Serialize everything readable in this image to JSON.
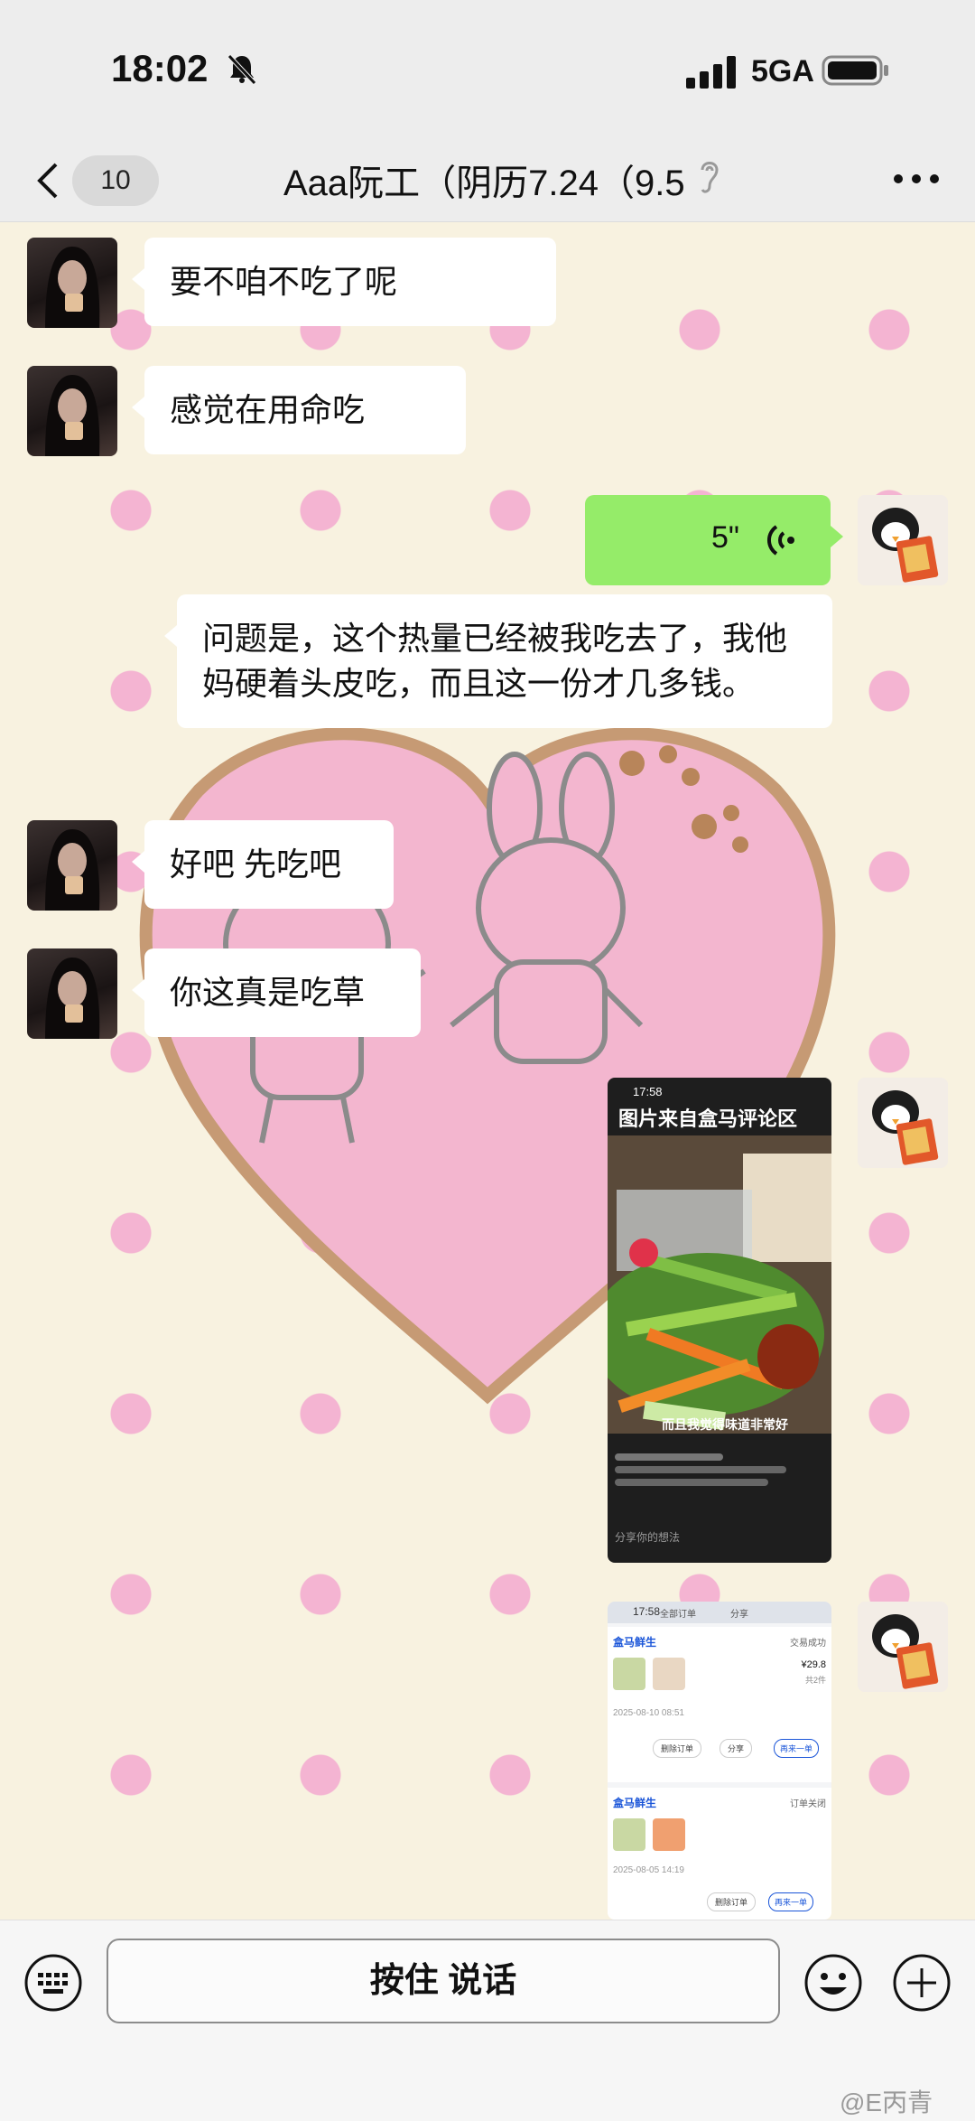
{
  "status_bar": {
    "time": "18:02",
    "network": "5GA"
  },
  "nav": {
    "back_count": "10",
    "title": "Aaa阮工（阴历7.24（9.5"
  },
  "messages": [
    {
      "from": "other",
      "text": "要不咱不吃了呢"
    },
    {
      "from": "other",
      "text": "感觉在用命吃"
    },
    {
      "from": "self",
      "type": "voice",
      "duration": "5\""
    },
    {
      "from": "other",
      "text": "问题是，这个热量已经被我吃去了，我他妈硬着头皮吃，而且这一份才几多钱。"
    },
    {
      "from": "other",
      "text": "好吧 先吃吧"
    },
    {
      "from": "other",
      "text": "你这真是吃草"
    },
    {
      "from": "self",
      "type": "image",
      "screenshot": {
        "time": "17:58",
        "title": "图片来自盒马评论区",
        "caption": "而且我觉得味道非常好",
        "comment_placeholder": "分享你的想法"
      }
    },
    {
      "from": "self",
      "type": "image",
      "screenshot": {
        "time": "17:58",
        "tab_orders": "全部订单",
        "tab_share": "分享",
        "store1": "盒马鲜生",
        "status1": "交易成功",
        "price1": "¥29.8",
        "count1": "共2件",
        "date1": "2025-08-10 08:51",
        "btn_delete": "删除订单",
        "btn_share": "分享",
        "btn_rebuy": "再来一单",
        "store2": "盒马鲜生",
        "status2": "订单关闭",
        "date2": "2025-08-05 14:19"
      }
    }
  ],
  "input_bar": {
    "hold_to_talk": "按住 说话"
  },
  "watermark": "@E丙青",
  "colors": {
    "self_bubble": "#95ec69",
    "other_bubble": "#ffffff",
    "wallpaper_dot": "#f4b4d2",
    "heart": "#f3b6cf"
  }
}
